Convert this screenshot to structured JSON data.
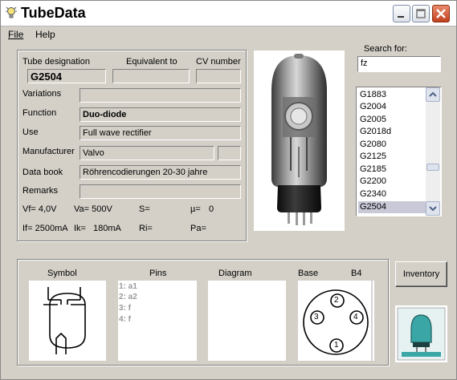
{
  "window": {
    "title": "TubeData"
  },
  "menu": {
    "file": "File",
    "help": "Help"
  },
  "labels": {
    "tube_designation": "Tube designation",
    "equivalent_to": "Equivalent to",
    "cv_number": "CV number",
    "variations": "Variations",
    "function": "Function",
    "use": "Use",
    "manufacturer": "Manufacturer",
    "data_book": "Data book",
    "remarks": "Remarks",
    "search_for": "Search for:"
  },
  "fields": {
    "tube_designation": "G2504",
    "equivalent_to": "",
    "cv_number": "",
    "variations": "",
    "function": "Duo-diode",
    "use": "Full wave rectifier",
    "manufacturer": "Valvo",
    "manufacturer_extra": "",
    "data_book": "Röhrencodierungen 20-30 jahre",
    "remarks": ""
  },
  "params": {
    "vf": "Vf= 4,0V",
    "va": "Va= 500V",
    "s": "S=",
    "mu": "µ=",
    "mu_val": "0",
    "if": "If= 2500mA",
    "ik": "Ik=",
    "ik_val": "180mA",
    "ri": "Ri=",
    "pa": "Pa="
  },
  "search": {
    "value": "fz"
  },
  "list": {
    "items": [
      "G1883",
      "G2004",
      "G2005",
      "G2018d",
      "G2080",
      "G2125",
      "G2185",
      "G2200",
      "G2340",
      "G2504"
    ],
    "selected": "G2504"
  },
  "bottom": {
    "symbol": "Symbol",
    "pins": "Pins",
    "diagram": "Diagram",
    "base": "Base",
    "base_type": "B4",
    "pin_list": [
      "1: a1",
      "2: a2",
      "3: f",
      "4: f"
    ],
    "base_pins": [
      "1",
      "2",
      "3",
      "4"
    ]
  },
  "buttons": {
    "inventory": "Inventory"
  },
  "icons": {
    "app": "lightbulb-icon",
    "minimize": "minimize-icon",
    "maximize": "maximize-icon",
    "close": "close-icon",
    "scroll_up": "chevron-up-icon",
    "scroll_down": "chevron-down-icon"
  },
  "colors": {
    "face": "#d4d0c8",
    "close_button": "#c2401f",
    "list_selection": "#c9c9d8",
    "pins_text": "#9a9a9a",
    "logo_teal": "#3aa6a6"
  }
}
